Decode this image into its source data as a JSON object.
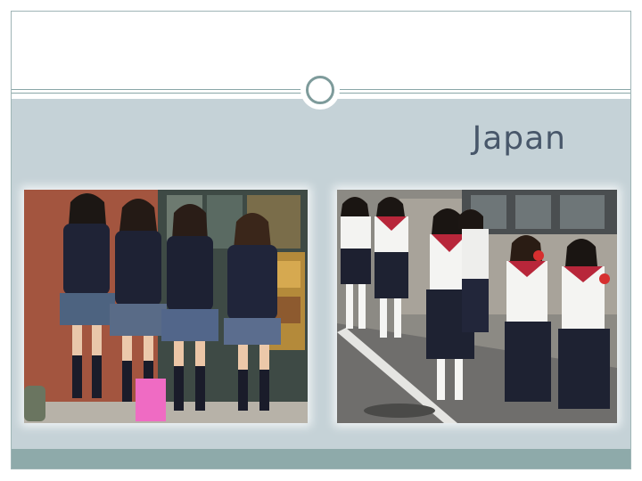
{
  "slide": {
    "title": "Japan"
  },
  "theme": {
    "accent": "#8eaaaa",
    "band": "#c5d2d7",
    "title_color": "#48576a"
  },
  "images": [
    {
      "name": "photo-students-blazers"
    },
    {
      "name": "photo-students-sailor-uniforms"
    }
  ]
}
